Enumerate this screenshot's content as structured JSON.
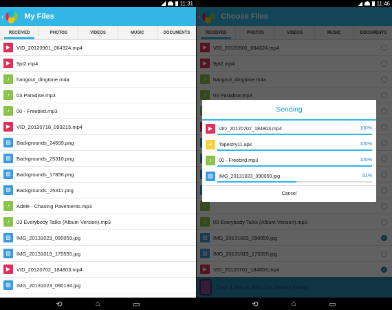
{
  "status": {
    "left_time": "11:31",
    "right_time": "11:46"
  },
  "left": {
    "title": "My Files",
    "tabs": [
      "RECEIVED",
      "PHOTOS",
      "VIDEOS",
      "MUSIC",
      "DOCUMENTS"
    ],
    "files": [
      {
        "name": "VID_20120901_064324.mp4",
        "type": "video"
      },
      {
        "name": "9pt2.mp4",
        "type": "video"
      },
      {
        "name": "hangout_dingtone.m4a",
        "type": "audio"
      },
      {
        "name": "03 Paradise.mp3",
        "type": "audio"
      },
      {
        "name": "00 - Freebird.mp3",
        "type": "audio"
      },
      {
        "name": "VID_20120718_093215.mp4",
        "type": "video"
      },
      {
        "name": "Backgrounds_24699.png",
        "type": "image"
      },
      {
        "name": "Backgrounds_25310.png",
        "type": "image"
      },
      {
        "name": "Backgrounds_17856.png",
        "type": "image"
      },
      {
        "name": "Backgrounds_25311.png",
        "type": "image"
      },
      {
        "name": "Adele - Chasing Pavements.mp3",
        "type": "audio"
      },
      {
        "name": "03 Everybody Talks (Album Version).mp3",
        "type": "audio"
      },
      {
        "name": "IMG_20131023_090059.jpg",
        "type": "image"
      },
      {
        "name": "IMG_20131019_175555.jpg",
        "type": "image"
      },
      {
        "name": "VID_20120702_184803.mp4",
        "type": "video"
      },
      {
        "name": "IMG_20131023_090134.jpg",
        "type": "image"
      }
    ]
  },
  "right": {
    "title": "Choose Files",
    "tabs": [
      "RECEIVED",
      "PHOTOS",
      "VIDEOS",
      "MUSIC",
      "DOCUMENTS"
    ],
    "files": [
      {
        "name": "VID_20120901_064324.mp4",
        "type": "video",
        "checked": false
      },
      {
        "name": "9pt2.mp4",
        "type": "video",
        "checked": false
      },
      {
        "name": "hangout_dingtone.m4a",
        "type": "audio",
        "checked": false
      },
      {
        "name": "03 Paradise.mp3",
        "type": "audio",
        "checked": false
      },
      {
        "name": "",
        "type": "audio",
        "checked": false
      },
      {
        "name": "",
        "type": "video",
        "checked": false
      },
      {
        "name": "",
        "type": "image",
        "checked": false
      },
      {
        "name": "",
        "type": "image",
        "checked": false
      },
      {
        "name": "",
        "type": "image",
        "checked": false
      },
      {
        "name": "",
        "type": "image",
        "checked": false
      },
      {
        "name": "",
        "type": "audio",
        "checked": false
      },
      {
        "name": "03 Everybody Talks (Album Version).mp3",
        "type": "audio",
        "checked": false
      },
      {
        "name": "IMG_20131023_090059.jpg",
        "type": "image",
        "checked": true
      },
      {
        "name": "IMG_20131019_175555.jpg",
        "type": "image",
        "checked": false
      },
      {
        "name": "VID_20120702_184803.mp4",
        "type": "video",
        "checked": true
      }
    ],
    "footer_text": "Drop 4 files to John D's Galaxy Nexus"
  },
  "dialog": {
    "title": "Sending",
    "items": [
      {
        "name": "VID_20120702_184803.mp4",
        "type": "video",
        "percent": 100,
        "label": "100%"
      },
      {
        "name": "Tapestry11.apk",
        "type": "doc",
        "percent": 100,
        "label": "100%"
      },
      {
        "name": "00 - Freebird.mp3",
        "type": "audio",
        "percent": 100,
        "label": "100%"
      },
      {
        "name": "IMG_20131023_090059.jpg",
        "type": "image",
        "percent": 51,
        "label": "51%"
      }
    ],
    "cancel_label": "Cancel"
  },
  "colors": {
    "accent": "#33b5e5",
    "video": "#e0305a",
    "audio": "#8bc34a",
    "image": "#3b9be0",
    "doc": "#f4d03f"
  },
  "icons": {
    "video": "play-icon",
    "audio": "music-note-icon",
    "image": "image-icon",
    "doc": "document-icon"
  }
}
